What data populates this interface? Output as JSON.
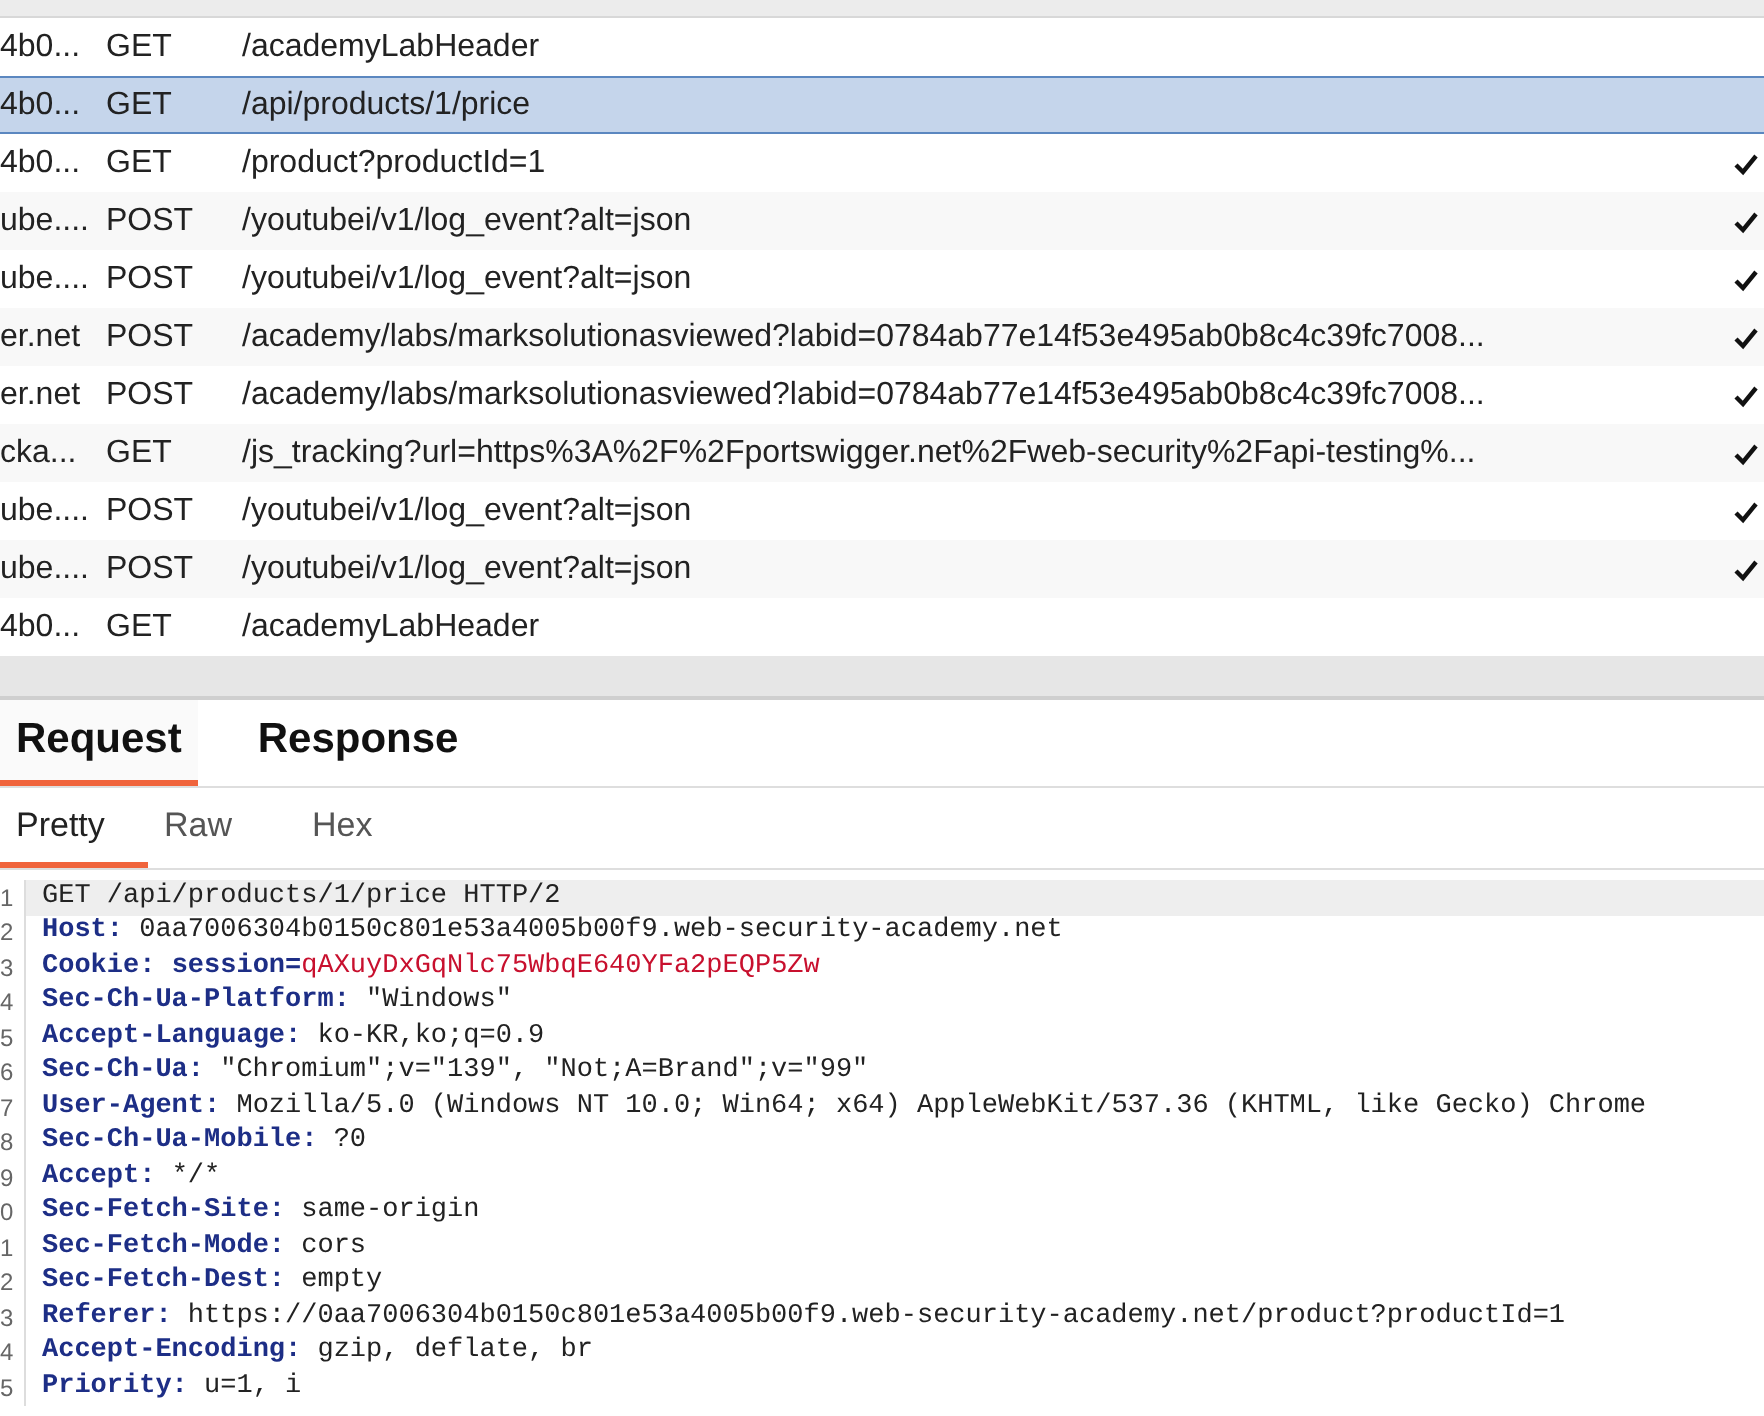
{
  "requests": [
    {
      "host": "4b0...",
      "method": "GET",
      "url": "/academyLabHeader",
      "selected": false,
      "checked": false
    },
    {
      "host": "4b0...",
      "method": "GET",
      "url": "/api/products/1/price",
      "selected": true,
      "checked": false
    },
    {
      "host": "4b0...",
      "method": "GET",
      "url": "/product?productId=1",
      "selected": false,
      "checked": true
    },
    {
      "host": "ube....",
      "method": "POST",
      "url": "/youtubei/v1/log_event?alt=json",
      "selected": false,
      "checked": true
    },
    {
      "host": "ube....",
      "method": "POST",
      "url": "/youtubei/v1/log_event?alt=json",
      "selected": false,
      "checked": true
    },
    {
      "host": "er.net",
      "method": "POST",
      "url": "/academy/labs/marksolutionasviewed?labid=0784ab77e14f53e495ab0b8c4c39fc7008...",
      "selected": false,
      "checked": true
    },
    {
      "host": "er.net",
      "method": "POST",
      "url": "/academy/labs/marksolutionasviewed?labid=0784ab77e14f53e495ab0b8c4c39fc7008...",
      "selected": false,
      "checked": true
    },
    {
      "host": "cka...",
      "method": "GET",
      "url": "/js_tracking?url=https%3A%2F%2Fportswigger.net%2Fweb-security%2Fapi-testing%...",
      "selected": false,
      "checked": true
    },
    {
      "host": "ube....",
      "method": "POST",
      "url": "/youtubei/v1/log_event?alt=json",
      "selected": false,
      "checked": true
    },
    {
      "host": "ube....",
      "method": "POST",
      "url": "/youtubei/v1/log_event?alt=json",
      "selected": false,
      "checked": true
    },
    {
      "host": "4b0...",
      "method": "GET",
      "url": "/academyLabHeader",
      "selected": false,
      "checked": false
    }
  ],
  "tabs": [
    {
      "label": "Request",
      "selected": true
    },
    {
      "label": "Response",
      "selected": false
    }
  ],
  "view_tabs": [
    {
      "label": "Pretty",
      "selected": true
    },
    {
      "label": "Raw",
      "selected": false
    },
    {
      "label": "Hex",
      "selected": false
    }
  ],
  "editor_lines": [
    {
      "number": "1",
      "kind": "request",
      "text": "GET /api/products/1/price HTTP/2",
      "current": true
    },
    {
      "number": "2",
      "kind": "header",
      "name": "Host:",
      "value": "0aa7006304b0150c801e53a4005b00f9.web-security-academy.net",
      "current": false
    },
    {
      "number": "3",
      "kind": "cookie",
      "name": "Cookie:",
      "cookie_name": "session=",
      "cookie_value": "qAXuyDxGqNlc75WbqE640YFa2pEQP5Zw",
      "current": false
    },
    {
      "number": "4",
      "kind": "header",
      "name": "Sec-Ch-Ua-Platform:",
      "value": "\"Windows\"",
      "current": false
    },
    {
      "number": "5",
      "kind": "header",
      "name": "Accept-Language:",
      "value": "ko-KR,ko;q=0.9",
      "current": false
    },
    {
      "number": "6",
      "kind": "header",
      "name": "Sec-Ch-Ua:",
      "value": "\"Chromium\";v=\"139\", \"Not;A=Brand\";v=\"99\"",
      "current": false
    },
    {
      "number": "7",
      "kind": "header",
      "name": "User-Agent:",
      "value": "Mozilla/5.0 (Windows NT 10.0; Win64; x64) AppleWebKit/537.36 (KHTML, like Gecko) Chrome",
      "current": false
    },
    {
      "number": "8",
      "kind": "header",
      "name": "Sec-Ch-Ua-Mobile:",
      "value": "?0",
      "current": false
    },
    {
      "number": "9",
      "kind": "header",
      "name": "Accept:",
      "value": "*/*",
      "current": false
    },
    {
      "number": "0",
      "kind": "header",
      "name": "Sec-Fetch-Site:",
      "value": "same-origin",
      "current": false
    },
    {
      "number": "1",
      "kind": "header",
      "name": "Sec-Fetch-Mode:",
      "value": "cors",
      "current": false
    },
    {
      "number": "2",
      "kind": "header",
      "name": "Sec-Fetch-Dest:",
      "value": "empty",
      "current": false
    },
    {
      "number": "3",
      "kind": "header",
      "name": "Referer:",
      "value": "https://0aa7006304b0150c801e53a4005b00f9.web-security-academy.net/product?productId=1",
      "current": false
    },
    {
      "number": "4",
      "kind": "header",
      "name": "Accept-Encoding:",
      "value": "gzip, deflate, br",
      "current": false
    },
    {
      "number": "5",
      "kind": "header",
      "name": "Priority:",
      "value": "u=1, i",
      "current": false
    }
  ]
}
